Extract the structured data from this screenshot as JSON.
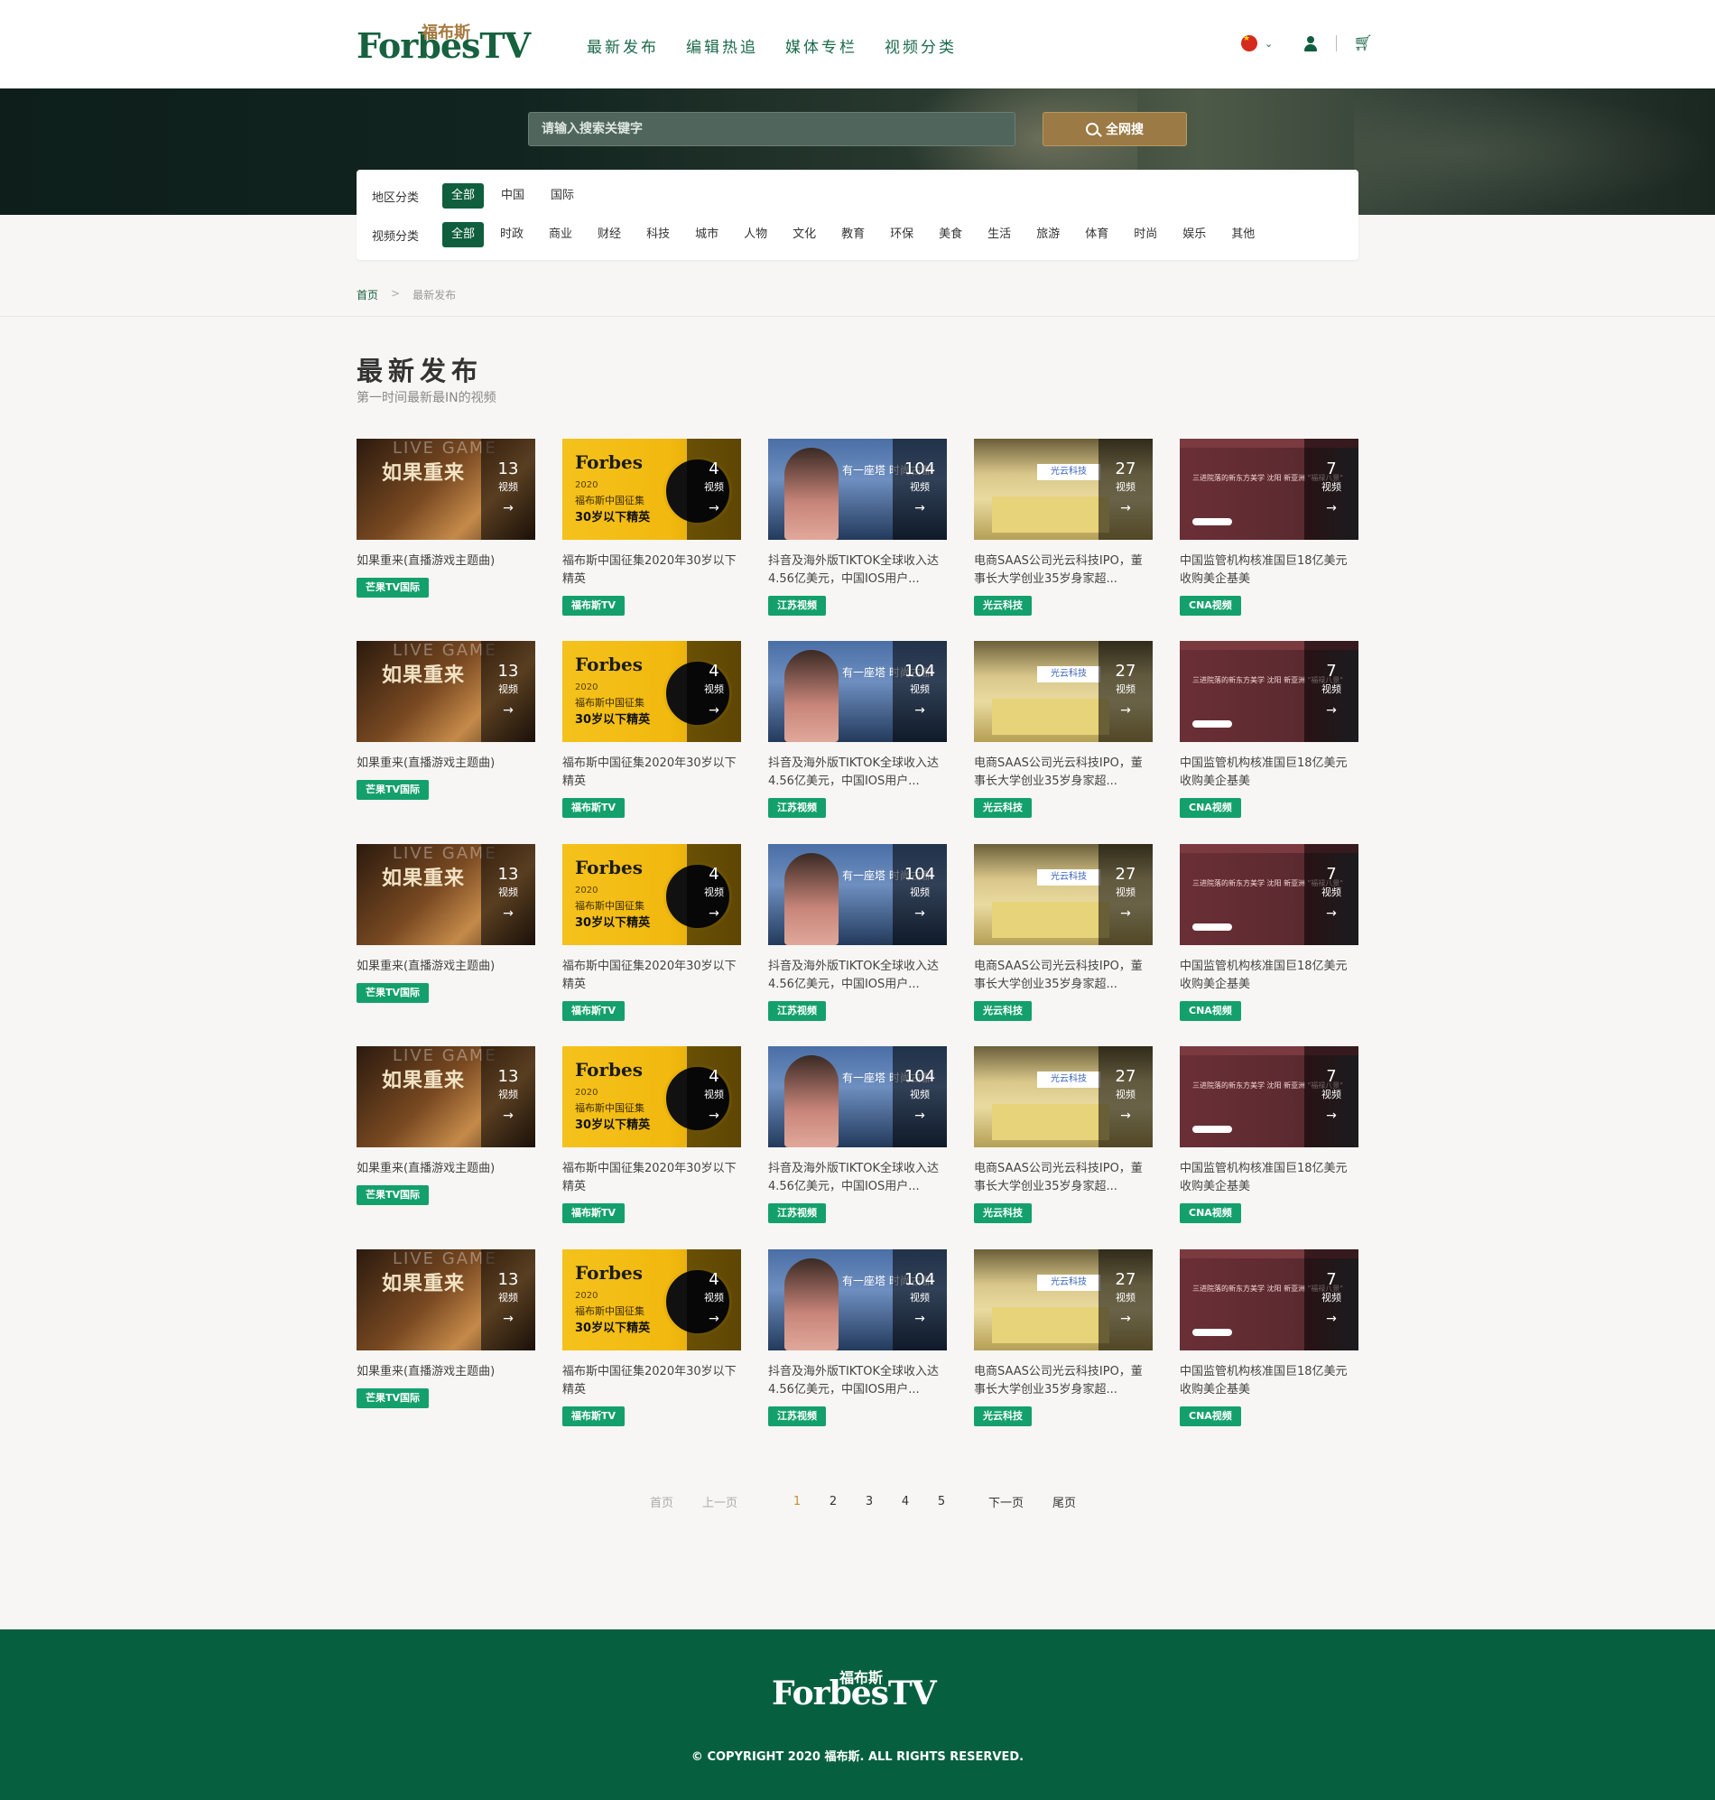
{
  "header": {
    "logo_text": "ForbesTV",
    "logo_cn": "福布斯",
    "nav": [
      "最新发布",
      "编辑热追",
      "媒体专栏",
      "视频分类"
    ],
    "lang_icon": "china-flag-icon",
    "user_icon": "user-icon",
    "cart_icon": "cart-icon"
  },
  "search": {
    "placeholder": "请输入搜索关键字",
    "button_label": "全网搜"
  },
  "filters": {
    "region_label": "地区分类",
    "region_options": [
      "全部",
      "中国",
      "国际"
    ],
    "category_label": "视频分类",
    "category_options": [
      "全部",
      "时政",
      "商业",
      "财经",
      "科技",
      "城市",
      "人物",
      "文化",
      "教育",
      "环保",
      "美食",
      "生活",
      "旅游",
      "体育",
      "时尚",
      "娱乐",
      "其他"
    ]
  },
  "breadcrumb": {
    "home": "首页",
    "separator": ">",
    "current": "最新发布"
  },
  "section": {
    "title": "最新发布",
    "subtitle": "第一时间最新最IN的视频"
  },
  "cards": [
    {
      "count": "13",
      "count_label": "视频",
      "title": "如果重来(直播游戏主题曲)",
      "tag": "芒果TV国际",
      "art_text": "如果重来",
      "art_bg_text": "LIVE GAME"
    },
    {
      "count": "4",
      "count_label": "视频",
      "title": "福布斯中国征集2020年30岁以下精英",
      "tag": "福布斯TV",
      "art_text": "Forbes",
      "art_year": "2020",
      "art_line1": "福布斯中国征集",
      "art_line2": "30岁以下精英"
    },
    {
      "count": "104",
      "count_label": "视频",
      "title": "抖音及海外版TIKTOK全球收入达4.56亿美元，中国IOS用户...",
      "tag": "江苏视频",
      "art_text": "有一座塔 时尚古都"
    },
    {
      "count": "27",
      "count_label": "视频",
      "title": "电商SAAS公司光云科技IPO，董事长大学创业35岁身家超...",
      "tag": "光云科技",
      "art_text": "光云科技"
    },
    {
      "count": "7",
      "count_label": "视频",
      "title": "中国监管机构核准国巨18亿美元收购美企基美",
      "tag": "CNA视频",
      "art_text": "三进院落的新东方美学 沈阳 新亚洲 \"福禄八景\""
    }
  ],
  "pager": {
    "first": "首页",
    "prev": "上一页",
    "pages": [
      "1",
      "2",
      "3",
      "4",
      "5"
    ],
    "current": "1",
    "next": "下一页",
    "last": "尾页"
  },
  "footer": {
    "logo_text": "ForbesTV",
    "logo_cn": "福布斯",
    "copyright": "© COPYRIGHT 2020 福布斯. ALL RIGHTS RESERVED."
  },
  "colors": {
    "brand_green": "#0f5e3d",
    "tag_green": "#14a06c",
    "search_gold": "#9b7a45",
    "footer_green": "#06603f",
    "pager_current": "#c2922f"
  }
}
